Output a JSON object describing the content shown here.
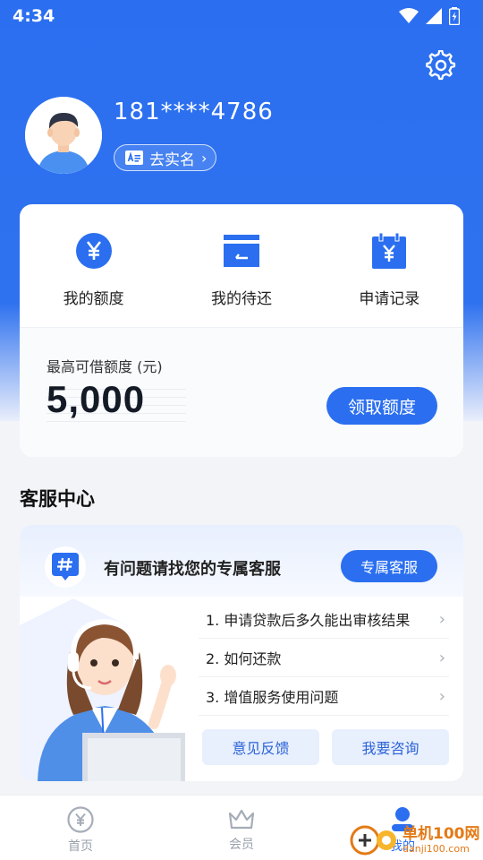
{
  "status_bar": {
    "time": "4:34"
  },
  "profile": {
    "phone": "181****4786",
    "realname_label": "去实名"
  },
  "quick_actions": [
    {
      "label": "我的额度",
      "icon": "yen-circle-icon"
    },
    {
      "label": "我的待还",
      "icon": "card-icon"
    },
    {
      "label": "申请记录",
      "icon": "calendar-yen-icon"
    }
  ],
  "credit": {
    "label": "最高可借额度 (元)",
    "value": "5,000",
    "claim_button": "领取额度"
  },
  "service": {
    "title": "客服中心",
    "prompt": "有问题请找您的专属客服",
    "exclusive_button": "专属客服",
    "faqs": [
      "1. 申请贷款后多久能出审核结果",
      "2. 如何还款",
      "3. 增值服务使用问题"
    ],
    "feedback_button": "意见反馈",
    "consult_button": "我要咨询"
  },
  "bottom_nav": [
    {
      "label": "首页",
      "icon": "yen-circle-icon"
    },
    {
      "label": "会员",
      "icon": "crown-icon"
    },
    {
      "label": "我的",
      "icon": "person-icon"
    }
  ],
  "watermark": {
    "name": "单机100网",
    "url": "danji100.com"
  },
  "colors": {
    "primary": "#2b6ff0",
    "background": "#f2f4f8"
  }
}
